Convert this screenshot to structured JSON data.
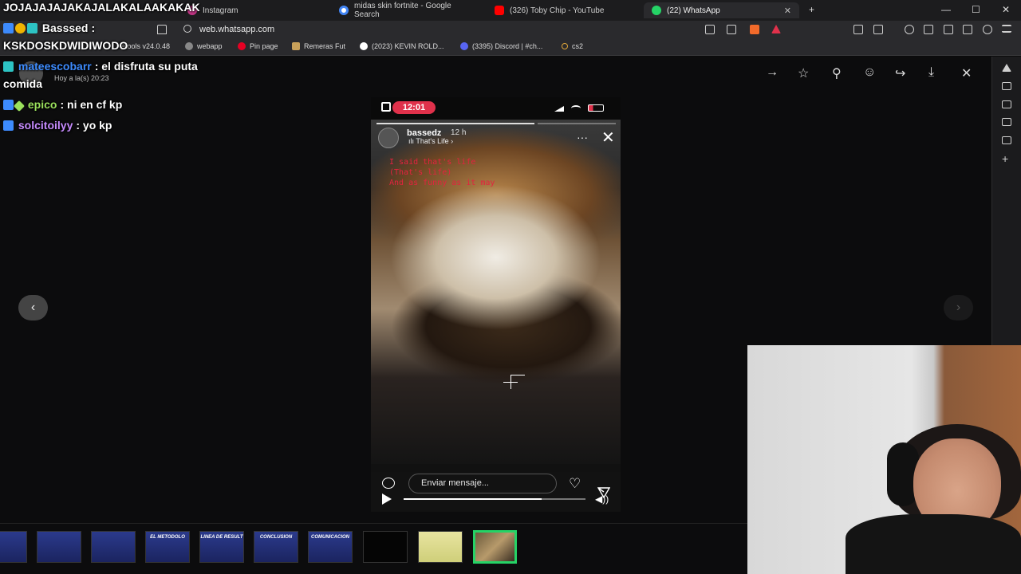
{
  "tabs": [
    {
      "label": "Instagram",
      "color": "#c13584"
    },
    {
      "label": "midas skin fortnite - Google Search",
      "color": "#4285f4"
    },
    {
      "label": "(326) Toby Chip - YouTube",
      "color": "#ff0000"
    },
    {
      "label": "(22) WhatsApp",
      "color": "#25d366",
      "close": "✕"
    }
  ],
  "new_tab": "+",
  "window": {
    "minimize": "—",
    "maximize": "☐",
    "close": "✕"
  },
  "url": "web.whatsapp.com",
  "bookmarks": [
    {
      "label": "etools v24.0.48"
    },
    {
      "label": "webapp"
    },
    {
      "label": "Pin page"
    },
    {
      "label": "Remeras Fut"
    },
    {
      "label": "(2023) KEVIN ROLD..."
    },
    {
      "label": "(3395) Discord | #ch..."
    },
    {
      "label": "cs2"
    }
  ],
  "viewer_toolbar": {
    "forward": "→",
    "star": "☆",
    "pin": "⚲",
    "emoji": "☺",
    "share": "↪",
    "download": "⤓",
    "close": "✕"
  },
  "sender_meta": "Hoy a la(s) 20:23",
  "story": {
    "time": "12:01",
    "username": "bassedz",
    "posted": "12 h",
    "song": "ılı That's Life ›",
    "more": "···",
    "close": "✕",
    "lyrics": [
      "I said that's life",
      "(That's life)",
      "And as funny as it may"
    ],
    "reply_placeholder": "Enviar mensaje...",
    "progress": 0.76,
    "seek": 0.76
  },
  "nav": {
    "prev": "‹",
    "next": "›"
  },
  "thumbnails": [
    "",
    "",
    "",
    "EL METODOLO",
    "LINEA DE RESULT",
    "CONCLUSION",
    "COMUNICACION",
    "",
    "",
    ""
  ],
  "chat": [
    {
      "name": "JOJAJAJAJAKAJALAKALAAKAKAK",
      "text": "",
      "color": "#ffffff"
    },
    {
      "name": "Basssed",
      "text": ":",
      "color": "#ffffff"
    },
    {
      "name": "KSKDOSKDWIDIWODO",
      "text": "",
      "color": "#ffffff"
    },
    {
      "name": "mateescobarr",
      "text": ": el disfruta su puta",
      "color": "#3d8bfd"
    },
    {
      "name": "comida",
      "text": "",
      "color": "#ffffff"
    },
    {
      "name": "epico",
      "text": ": ni en cf kp",
      "color": "#9be15d"
    },
    {
      "name": "solcitoilyy",
      "text": ": yo kp",
      "color": "#c78cff"
    }
  ]
}
